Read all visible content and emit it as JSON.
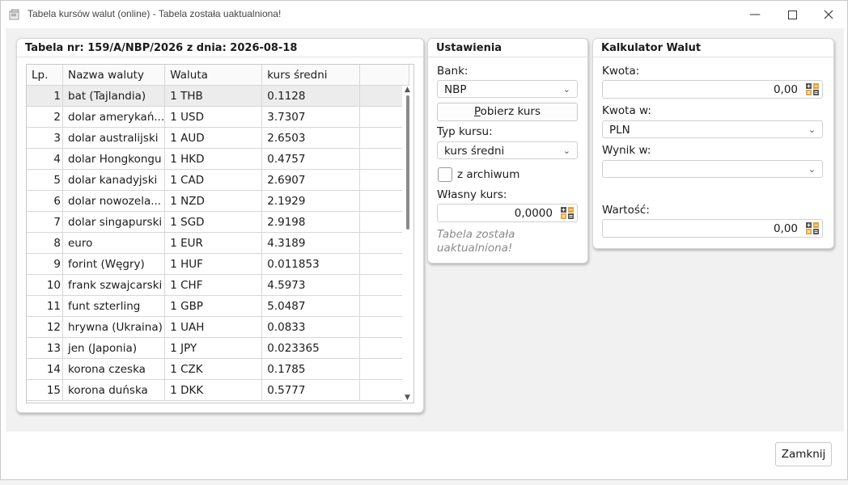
{
  "window": {
    "title": "Tabela kursów walut (online) - Tabela została uaktualniona!",
    "minimize_glyph": "—",
    "maximize_glyph": "☐",
    "close_glyph": "✕",
    "icon": "app-icon"
  },
  "table_panel": {
    "title": "Tabela nr: 159/A/NBP/2026 z dnia: 2026-08-18",
    "columns": [
      "Lp.",
      "Nazwa waluty",
      "Waluta",
      "kurs średni"
    ],
    "rows": [
      [
        "1",
        "bat (Tajlandia)",
        "1 THB",
        "0.1128"
      ],
      [
        "2",
        "dolar amerykań...",
        "1 USD",
        "3.7307"
      ],
      [
        "3",
        "dolar australijski",
        "1 AUD",
        "2.6503"
      ],
      [
        "4",
        "dolar Hongkongu",
        "1 HKD",
        "0.4757"
      ],
      [
        "5",
        "dolar kanadyjski",
        "1 CAD",
        "2.6907"
      ],
      [
        "6",
        "dolar nowozela...",
        "1 NZD",
        "2.1929"
      ],
      [
        "7",
        "dolar singapurski",
        "1 SGD",
        "2.9198"
      ],
      [
        "8",
        "euro",
        "1 EUR",
        "4.3189"
      ],
      [
        "9",
        "forint (Węgry)",
        "1 HUF",
        "0.011853"
      ],
      [
        "10",
        "frank szwajcarski",
        "1 CHF",
        "4.5973"
      ],
      [
        "11",
        "funt szterling",
        "1 GBP",
        "5.0487"
      ],
      [
        "12",
        "hrywna (Ukraina)",
        "1 UAH",
        "0.0833"
      ],
      [
        "13",
        "jen (Japonia)",
        "1 JPY",
        "0.023365"
      ],
      [
        "14",
        "korona czeska",
        "1 CZK",
        "0.1785"
      ],
      [
        "15",
        "korona duńska",
        "1 DKK",
        "0.5777"
      ]
    ],
    "selected_row": 1
  },
  "settings": {
    "title": "Ustawienia",
    "bank_label": "Bank:",
    "bank_value": "NBP",
    "fetch_button_prefix": "P",
    "fetch_button_rest": "obierz kurs",
    "rate_type_label": "Typ kursu:",
    "rate_type_value": "kurs średni",
    "archive_label": "z archiwum",
    "archive_checked": false,
    "own_rate_label": "Własny kurs:",
    "own_rate_value": "0,0000",
    "status_text": "Tabela została uaktualniona!"
  },
  "calculator": {
    "title": "Kalkulator Walut",
    "amount_label": "Kwota:",
    "amount_value": "0,00",
    "amount_in_label": "Kwota w:",
    "amount_in_value": "PLN",
    "result_in_label": "Wynik w:",
    "result_in_value": "",
    "value_label": "Wartość:",
    "value_value": "0,00"
  },
  "footer": {
    "close_label": "Zamknij"
  },
  "colors": {
    "selected_row": "#ececec",
    "status_text": "#8a8a8a",
    "calc_icon_orange": "#e8a33a",
    "calc_icon_dark": "#555555"
  }
}
